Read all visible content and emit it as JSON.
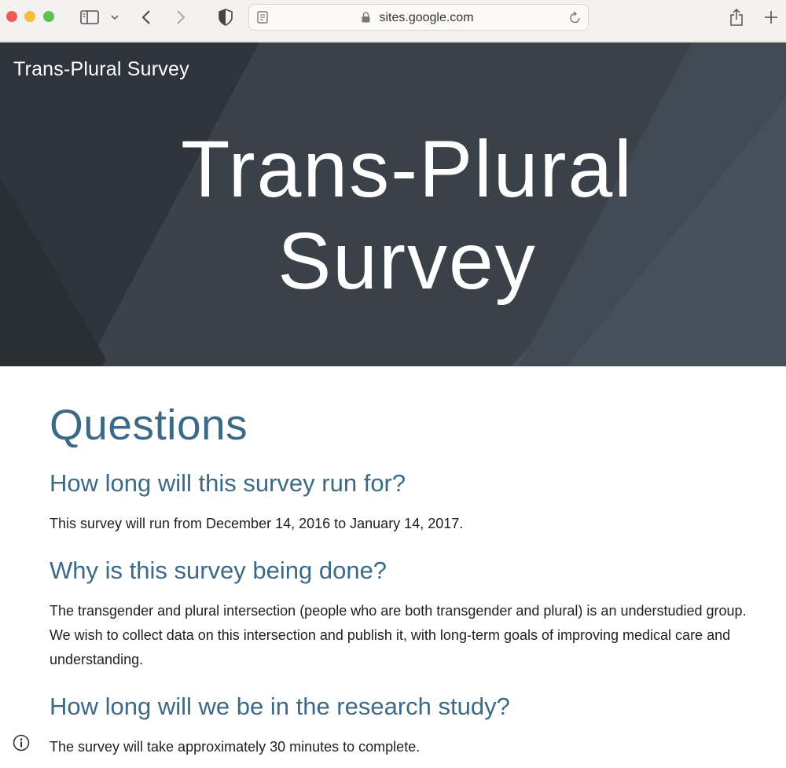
{
  "browser": {
    "url": "sites.google.com",
    "icons": [
      "sidebar-icon",
      "chevron-down-icon",
      "back-icon",
      "forward-icon",
      "shield-icon",
      "reader-icon",
      "lock-icon",
      "reload-icon",
      "share-icon",
      "new-tab-icon"
    ]
  },
  "site": {
    "title": "Trans-Plural Survey"
  },
  "hero": {
    "line1": "Trans-Plural",
    "line2": "Survey",
    "colors": {
      "background": "#3f464f",
      "text": "#ffffff"
    }
  },
  "main": {
    "heading": "Questions",
    "sections": [
      {
        "question": "How long will this survey run for?",
        "answer": "This survey will run from December 14, 2016 to January 14, 2017."
      },
      {
        "question": "Why is this survey being done?",
        "answer": "The transgender and plural intersection (people who are both transgender and plural) is an understudied group. We wish to collect data on this intersection and publish it, with long-term goals of improving medical care and understanding."
      },
      {
        "question": "How long will we be in the research study?",
        "answer": "The survey will take approximately 30 minutes to complete."
      }
    ],
    "colors": {
      "heading": "#3c6a86",
      "body": "#1f1f1f"
    }
  }
}
